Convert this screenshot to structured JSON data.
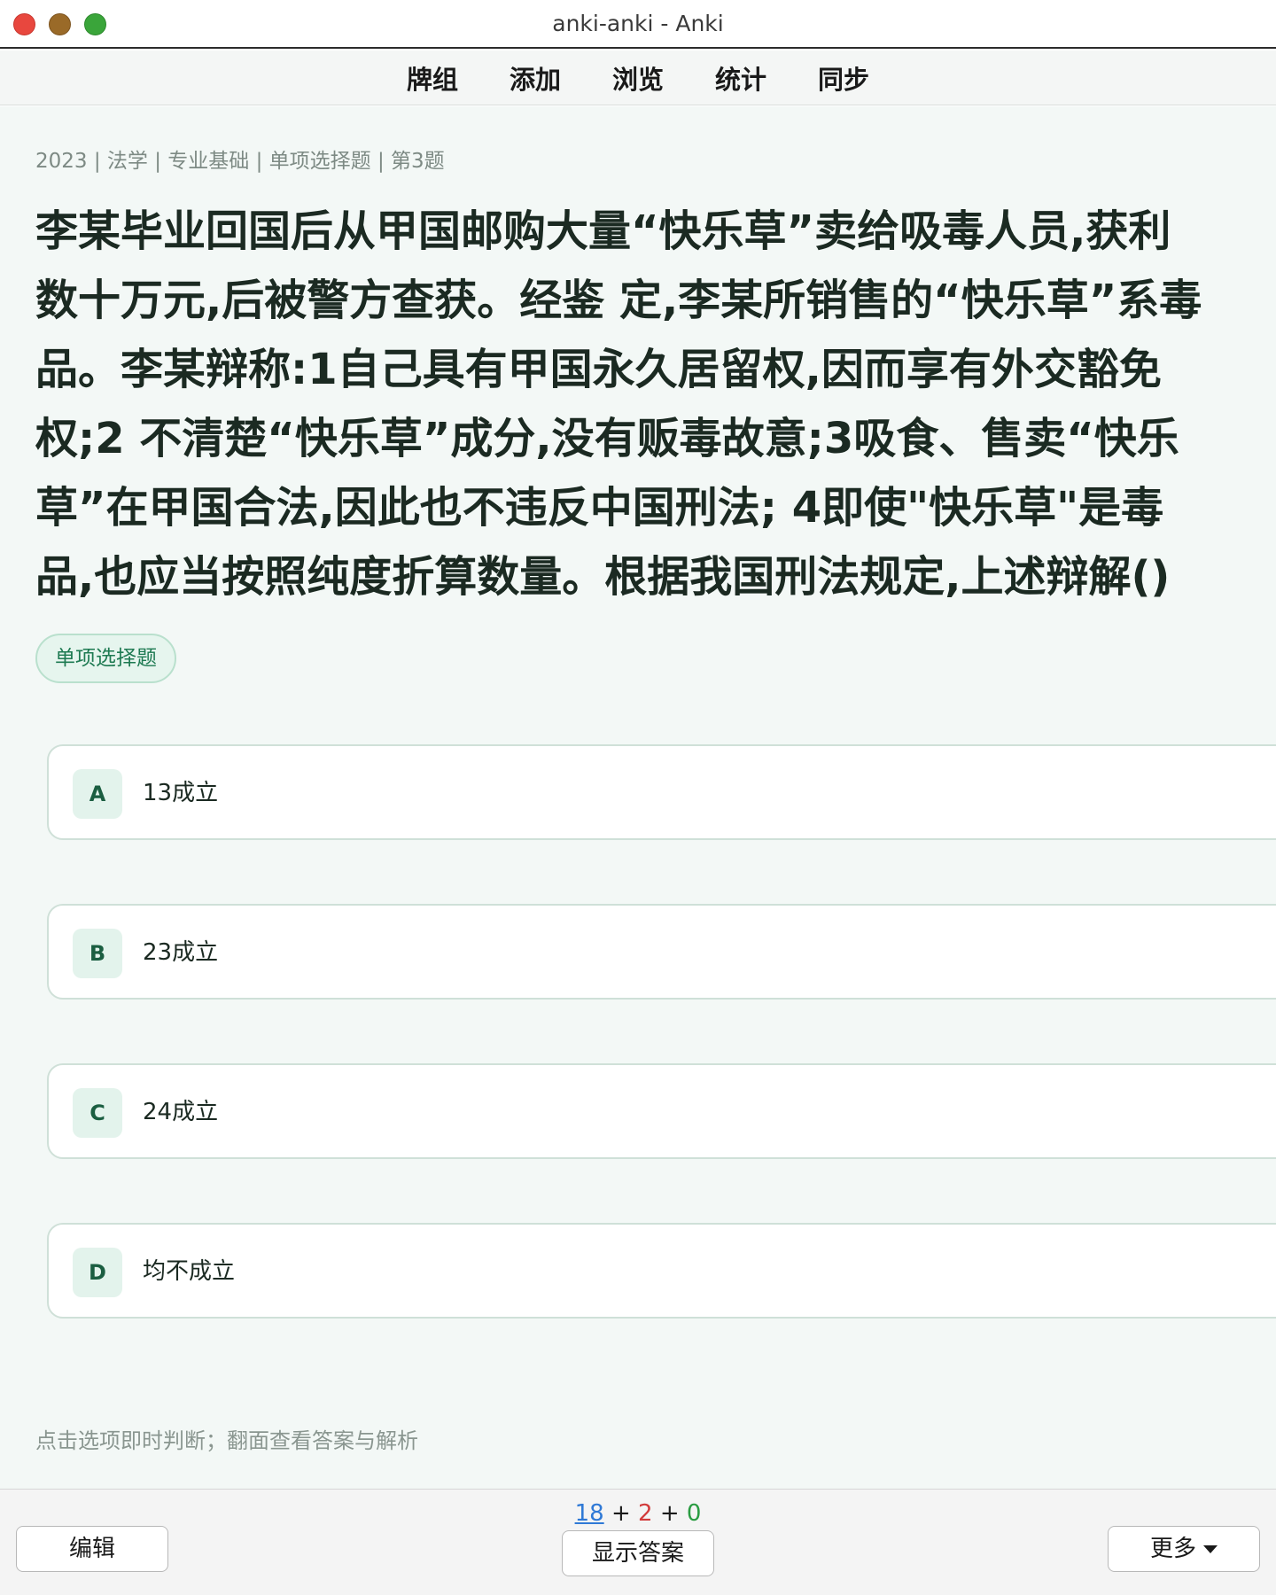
{
  "window": {
    "title": "anki-anki - Anki"
  },
  "toolbar": {
    "items": [
      "牌组",
      "添加",
      "浏览",
      "统计",
      "同步"
    ]
  },
  "card": {
    "breadcrumb": "2023 | 法学 | 专业基础 | 单项选择题 | 第3题",
    "question_lines": [
      "李某毕业回国后从甲国邮购大量“快乐草”卖给吸毒人员,获利",
      "数十万元,后被警方查获。经鉴 定,李某所销售的“快乐草”系毒",
      "品。李某辩称:1自己具有甲国永久居留权,因而享有外交豁免",
      "权;2 不清楚“快乐草”成分,没有贩毒故意;3吸食、售卖“快乐",
      "草”在甲国合法,因此也不违反中国刑法; 4即使\"快乐草\"是毒",
      "品,也应当按照纯度折算数量。根据我国刑法规定,上述辩解()"
    ],
    "type_tag": "单项选择题",
    "options": [
      {
        "letter": "A",
        "text": "13成立"
      },
      {
        "letter": "B",
        "text": "23成立"
      },
      {
        "letter": "C",
        "text": "24成立"
      },
      {
        "letter": "D",
        "text": "均不成立"
      }
    ],
    "hint": "点击选项即时判断；翻面查看答案与解析"
  },
  "bottom": {
    "edit_label": "编辑",
    "show_answer_label": "显示答案",
    "more_label": "更多",
    "counts": {
      "new": "18",
      "learn": "2",
      "review": "0",
      "sep": "+"
    }
  },
  "colors": {
    "accent": "#1e7a52",
    "new_count": "#2f79d6",
    "learn_count": "#d23b3b",
    "review_count": "#2a9c42"
  }
}
